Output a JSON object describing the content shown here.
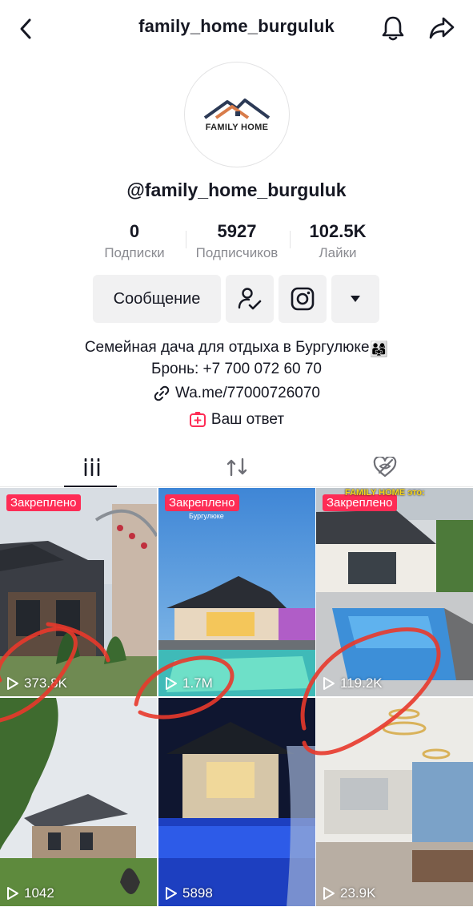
{
  "header": {
    "title": "family_home_burguluk",
    "back_icon": "chevron-left-icon",
    "bell_icon": "bell-icon",
    "share_icon": "share-icon"
  },
  "avatar": {
    "logo_text": "FAMILY HOME"
  },
  "profile": {
    "username": "@family_home_burguluk"
  },
  "stats": [
    {
      "value": "0",
      "label": "Подписки"
    },
    {
      "value": "5927",
      "label": "Подписчиков"
    },
    {
      "value": "102.5K",
      "label": "Лайки"
    }
  ],
  "buttons": {
    "message": "Сообщение",
    "follow_icon": "user-check-icon",
    "instagram_icon": "instagram-icon",
    "more_icon": "caret-down-icon"
  },
  "bio": {
    "line1": "Семейная дача для отдыха в Бургулюке",
    "line1_emoji": "👨‍👩‍👧",
    "line2": "Бронь: +7 700 072 60 70"
  },
  "link": {
    "text": "Wa.me/77000726070",
    "icon": "link-icon"
  },
  "reply": {
    "text": "Ваш ответ",
    "icon": "reply-plus-icon"
  },
  "tabs": [
    {
      "name": "videos",
      "icon": "grid-icon",
      "active": true
    },
    {
      "name": "reposts",
      "icon": "repost-icon",
      "active": false
    },
    {
      "name": "liked",
      "icon": "hidden-heart-icon",
      "active": false
    }
  ],
  "videos": [
    {
      "pinned": "Закреплено",
      "views": "373.8K",
      "overlay_text": ""
    },
    {
      "pinned": "Закреплено",
      "views": "1.7M",
      "overlay_text": "Бургулюке"
    },
    {
      "pinned": "Закреплено",
      "views": "119.2K",
      "overlay_text": "FAMILY HOME это:"
    },
    {
      "pinned": "",
      "views": "1042",
      "overlay_text": ""
    },
    {
      "pinned": "",
      "views": "5898",
      "overlay_text": ""
    },
    {
      "pinned": "",
      "views": "23.9K",
      "overlay_text": ""
    }
  ],
  "colors": {
    "pinned_bg": "#fe2c55",
    "muted_text": "#8a8b91",
    "button_bg": "#f1f1f2",
    "annotation_red": "#e8392b"
  }
}
